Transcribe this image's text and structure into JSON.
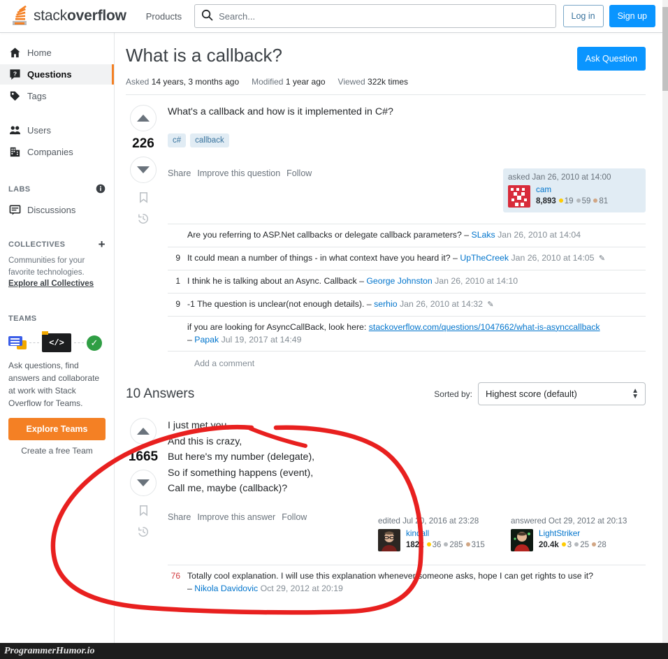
{
  "topbar": {
    "logo_text_light": "stack",
    "logo_text_bold": "overflow",
    "products_label": "Products",
    "search_placeholder": "Search...",
    "search_value": "",
    "login_label": "Log in",
    "signup_label": "Sign up"
  },
  "sidebar": {
    "items": [
      {
        "label": "Home",
        "icon": "home-icon",
        "active": false
      },
      {
        "label": "Questions",
        "icon": "question-icon",
        "active": true
      },
      {
        "label": "Tags",
        "icon": "tag-icon",
        "active": false
      },
      {
        "label": "Users",
        "icon": "users-icon",
        "active": false
      },
      {
        "label": "Companies",
        "icon": "building-icon",
        "active": false
      },
      {
        "label": "Discussions",
        "icon": "discussion-icon",
        "active": false
      }
    ],
    "labs_heading": "LABS",
    "collectives_heading": "COLLECTIVES",
    "collectives_blurb": "Communities for your favorite technologies. ",
    "collectives_link": "Explore all Collectives",
    "teams_heading": "TEAMS",
    "teams_blurb": "Ask questions, find answers and collaborate at work with Stack Overflow for Teams.",
    "explore_teams_label": "Explore Teams",
    "create_team_label": "Create a free Team"
  },
  "question": {
    "title": "What is a callback?",
    "ask_button": "Ask Question",
    "meta": {
      "asked_label": "Asked",
      "asked_value": "14 years, 3 months ago",
      "modified_label": "Modified",
      "modified_value": "1 year ago",
      "viewed_label": "Viewed",
      "viewed_value": "322k times"
    },
    "votes": "226",
    "body": "What's a callback and how is it implemented in C#?",
    "tags": [
      "c#",
      "callback"
    ],
    "actions": [
      "Share",
      "Improve this question",
      "Follow"
    ],
    "asked_card": {
      "when": "asked Jan 26, 2010 at 14:00",
      "user": "cam",
      "rep": "8,893",
      "gold": "19",
      "silver": "59",
      "bronze": "81"
    },
    "comments": [
      {
        "score": "",
        "text": "Are you referring to ASP.Net callbacks or delegate callback parameters?",
        "user": "SLaks",
        "date": "Jan 26, 2010 at 14:04",
        "edit": false
      },
      {
        "score": "9",
        "text": "It could mean a number of things - in what context have you heard it?",
        "user": "UpTheCreek",
        "date": "Jan 26, 2010 at 14:05",
        "edit": true
      },
      {
        "score": "1",
        "text": "I think he is talking about an Async. Callback",
        "user": "George Johnston",
        "date": "Jan 26, 2010 at 14:10",
        "edit": false
      },
      {
        "score": "9",
        "text": "-1 The question is unclear(not enough details).",
        "user": "serhio",
        "date": "Jan 26, 2010 at 14:32",
        "edit": true
      },
      {
        "score": "",
        "text": "if you are looking for AsyncCallBack, look here:",
        "link": "stackoverflow.com/questions/1047662/what-is-asynccallback",
        "user": "Papak",
        "date": "Jul 19, 2017 at 14:49",
        "edit": false
      }
    ],
    "add_comment": "Add a comment"
  },
  "answers_section": {
    "count_label": "10 Answers",
    "sorted_by_label": "Sorted by:",
    "sort_value": "Highest score (default)"
  },
  "answer": {
    "votes": "1665",
    "lines": [
      "I just met you,",
      "And this is crazy,",
      "But here's my number (delegate),",
      "So if something happens (event),",
      "Call me, maybe (callback)?"
    ],
    "actions": [
      "Share",
      "Improve this answer",
      "Follow"
    ],
    "edited_card": {
      "when": "edited Jul 20, 2016 at 23:28",
      "user": "kindall",
      "rep": "182k",
      "gold": "36",
      "silver": "285",
      "bronze": "315"
    },
    "answered_card": {
      "when": "answered Oct 29, 2012 at 20:13",
      "user": "LightStriker",
      "rep": "20.4k",
      "gold": "3",
      "silver": "25",
      "bronze": "28"
    },
    "comments": [
      {
        "score": "76",
        "text": "Totally cool explanation. I will use this explanation whenever someone asks, hope I can get rights to use it?",
        "user": "Nikola Davidovic",
        "date": "Oct 29, 2012 at 20:19"
      }
    ]
  },
  "annotation": {
    "color": "#e8201f",
    "shape": "hand-drawn-ellipse"
  },
  "watermark": {
    "text": "ProgrammerHumor.io"
  },
  "colors": {
    "accent_orange": "#f48024",
    "link_blue": "#0074cc",
    "button_blue": "#0a95ff",
    "tag_bg": "#e1ecf4",
    "tag_fg": "#39739d"
  }
}
